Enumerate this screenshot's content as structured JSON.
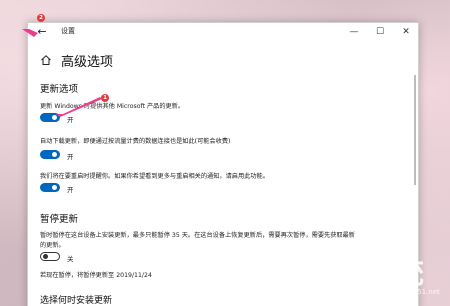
{
  "app": {
    "title": "设置",
    "back_icon": "back-arrow-icon"
  },
  "window_controls": {
    "minimize": "—",
    "maximize": "☐",
    "close": "✕"
  },
  "annotations": {
    "badge_back": "2",
    "badge_toggle": "1",
    "color": "#e23b3b"
  },
  "page": {
    "title": "高级选项"
  },
  "update_options": {
    "title": "更新选项",
    "items": [
      {
        "desc": "更新 Windows 时提供其他 Microsoft 产品的更新。",
        "state": "开"
      },
      {
        "desc": "自动下载更新，即便通过按流量计费的数据连接也是如此(可能会收费)",
        "state": "开"
      },
      {
        "desc": "我们将在要重启时提醒你。如果你希望看到更多与重启相关的通知，请启用此功能。",
        "state": "开"
      }
    ]
  },
  "pause_updates": {
    "title": "暂停更新",
    "desc_line1": "暂时暂停在这台设备上安装更新，最多只能暂停 35 天。在这台设备上恢复更新后，需要再次暂停，需要先获取最新",
    "desc_line2": "的更新。",
    "state": "关",
    "note": "若现在暂停，将暂停更新至 2019/11/24"
  },
  "next_section": {
    "title": "选择何时安装更新"
  },
  "colors": {
    "toggle_on": "#0067c0",
    "accent": "#0067c0"
  },
  "watermark": {
    "char": "统",
    "sub": "www.jb51.net"
  }
}
